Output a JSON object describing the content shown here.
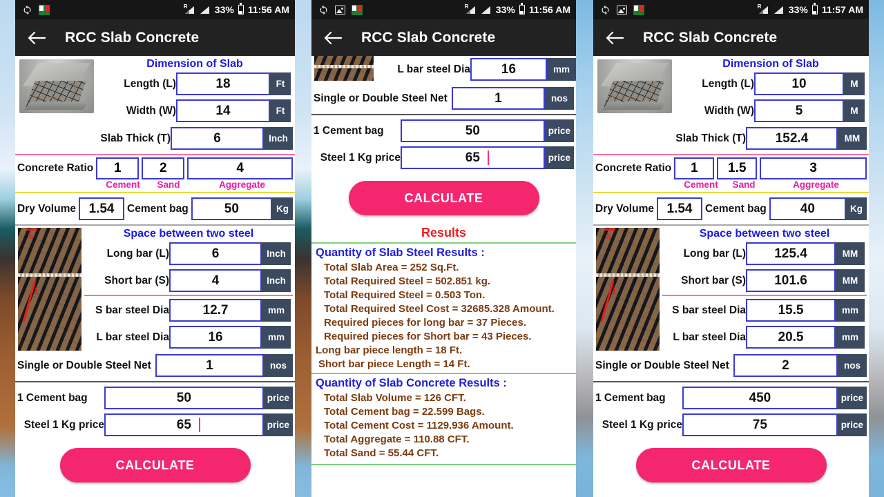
{
  "statusbar": {
    "icons": [
      "sync-icon",
      "photo-icon",
      "book-icon",
      "signal-roaming-icon",
      "signal-icon"
    ],
    "roaming_letter": "R",
    "battery_percent": "33%",
    "time_1": "11:56 AM",
    "time_2": "11:56 AM",
    "time_3": "11:57 AM"
  },
  "appbar": {
    "back": "back-arrow",
    "title": "RCC Slab Concrete"
  },
  "colors": {
    "accent_pink": "#f4276e",
    "label_blue": "#1919e6",
    "caption_magenta": "#e91ea2",
    "results_red": "#ef1d1d",
    "results_brown": "#7b3b10",
    "unit_slate": "#3b4a5f",
    "input_border": "#3a3ad6"
  },
  "panel1": {
    "dimension_title": "Dimension of Slab",
    "fields": [
      {
        "label": "Length (L)",
        "value": "18",
        "unit": "Ft"
      },
      {
        "label": "Width (W)",
        "value": "14",
        "unit": "Ft"
      },
      {
        "label": "Slab Thick (T)",
        "value": "6",
        "unit": "Inch"
      }
    ],
    "ratio_label": "Concrete Ratio",
    "ratio_values": [
      "1",
      "2",
      "4"
    ],
    "ratio_captions": [
      "Cement",
      "Sand",
      "Aggregate"
    ],
    "dry_volume_label": "Dry Volume",
    "dry_volume_value": "1.54",
    "cement_bag_label": "Cement bag",
    "cement_bag_value": "50",
    "cement_bag_unit": "Kg",
    "space_title": "Space between two steel",
    "steel_fields": [
      {
        "label": "Long bar (L)",
        "value": "6",
        "unit": "Inch"
      },
      {
        "label": "Short bar (S)",
        "value": "4",
        "unit": "Inch"
      },
      {
        "label": "S bar steel Dia",
        "value": "12.7",
        "unit": "mm"
      },
      {
        "label": "L bar steel Dia",
        "value": "16",
        "unit": "mm"
      }
    ],
    "net_label": "Single or Double Steel Net",
    "net_value": "1",
    "net_unit": "nos",
    "price_fields": [
      {
        "label": "1 Cement bag",
        "value": "50",
        "unit": "price",
        "caret": false
      },
      {
        "label": "Steel 1 Kg price",
        "value": "65",
        "unit": "price",
        "caret": true
      }
    ],
    "calculate": "CALCULATE"
  },
  "panel2": {
    "fields": [
      {
        "label": "L bar steel Dia",
        "value": "16",
        "unit": "mm"
      }
    ],
    "net_label": "Single or Double Steel Net",
    "net_value": "1",
    "net_unit": "nos",
    "price_fields": [
      {
        "label": "1 Cement bag",
        "value": "50",
        "unit": "price",
        "caret": false
      },
      {
        "label": "Steel 1 Kg price",
        "value": "65",
        "unit": "price",
        "caret": true
      }
    ],
    "calculate": "CALCULATE",
    "results_title": "Results",
    "steel_heading": "Quantity of Slab Steel Results :",
    "steel_lines": [
      "Total Slab Area = 252 Sq.Ft.",
      "Total Required Steel = 502.851 kg.",
      "Total Required Steel = 0.503 Ton.",
      "Total Required Steel Cost = 32685.328 Amount.",
      "Required pieces for long bar  = 37 Pieces.",
      "Required pieces for Short bar = 43 Pieces.",
      "Long bar piece length = 18 Ft.",
      "Short bar piece Length = 14 Ft."
    ],
    "concrete_heading": "Quantity of Slab Concrete Results :",
    "concrete_lines": [
      "Total Slab Volume = 126 CFT.",
      "Total Cement bag = 22.599 Bags.",
      "Total Cement Cost = 1129.936 Amount.",
      "Total Aggregate = 110.88 CFT.",
      "Total Sand = 55.44 CFT."
    ]
  },
  "panel3": {
    "dimension_title": "Dimension of Slab",
    "fields": [
      {
        "label": "Length (L)",
        "value": "10",
        "unit": "M"
      },
      {
        "label": "Width (W)",
        "value": "5",
        "unit": "M"
      },
      {
        "label": "Slab Thick (T)",
        "value": "152.4",
        "unit": "MM"
      }
    ],
    "ratio_label": "Concrete Ratio",
    "ratio_values": [
      "1",
      "1.5",
      "3"
    ],
    "ratio_captions": [
      "Cement",
      "Sand",
      "Aggregate"
    ],
    "dry_volume_label": "Dry Volume",
    "dry_volume_value": "1.54",
    "cement_bag_label": "Cement bag",
    "cement_bag_value": "40",
    "cement_bag_unit": "Kg",
    "space_title": "Space between two steel",
    "steel_fields": [
      {
        "label": "Long bar (L)",
        "value": "125.4",
        "unit": "MM"
      },
      {
        "label": "Short bar (S)",
        "value": "101.6",
        "unit": "MM"
      },
      {
        "label": "S bar steel Dia",
        "value": "15.5",
        "unit": "mm"
      },
      {
        "label": "L bar steel Dia",
        "value": "20.5",
        "unit": "mm"
      }
    ],
    "net_label": "Single or Double Steel Net",
    "net_value": "2",
    "net_unit": "nos",
    "price_fields": [
      {
        "label": "1 Cement bag",
        "value": "450",
        "unit": "price",
        "caret": false
      },
      {
        "label": "Steel 1 Kg price",
        "value": "75",
        "unit": "price",
        "caret": false
      }
    ],
    "calculate": "CALCULATE"
  }
}
